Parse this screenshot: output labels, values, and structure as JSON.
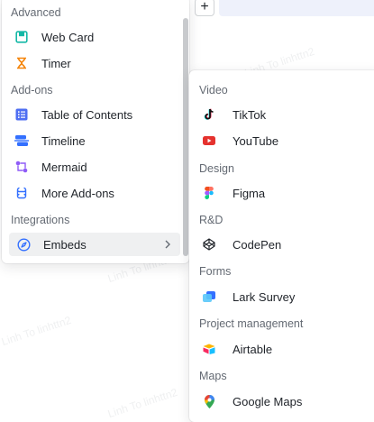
{
  "watermark": "Linh To linhttn2",
  "left_menu": {
    "groups": [
      {
        "title": "Advanced",
        "items": [
          {
            "label": "Web Card",
            "icon": "web-card-icon"
          },
          {
            "label": "Timer",
            "icon": "timer-icon"
          }
        ]
      },
      {
        "title": "Add-ons",
        "items": [
          {
            "label": "Table of Contents",
            "icon": "table-of-contents-icon"
          },
          {
            "label": "Timeline",
            "icon": "timeline-icon"
          },
          {
            "label": "Mermaid",
            "icon": "mermaid-icon"
          },
          {
            "label": "More Add-ons",
            "icon": "more-addons-icon"
          }
        ]
      },
      {
        "title": "Integrations",
        "items": [
          {
            "label": "Embeds",
            "icon": "compass-icon"
          }
        ]
      }
    ]
  },
  "right_menu": {
    "groups": [
      {
        "title": "Video",
        "items": [
          {
            "label": "TikTok"
          },
          {
            "label": "YouTube"
          }
        ]
      },
      {
        "title": "Design",
        "items": [
          {
            "label": "Figma"
          }
        ]
      },
      {
        "title": "R&D",
        "items": [
          {
            "label": "CodePen"
          }
        ]
      },
      {
        "title": "Forms",
        "items": [
          {
            "label": "Lark Survey"
          }
        ]
      },
      {
        "title": "Project management",
        "items": [
          {
            "label": "Airtable"
          }
        ]
      },
      {
        "title": "Maps",
        "items": [
          {
            "label": "Google Maps"
          }
        ]
      }
    ]
  },
  "colors": {
    "accent": "#3370ff",
    "timer": "#f5850a",
    "mermaid": "#8f5cf7",
    "youtube": "#e5322e"
  }
}
